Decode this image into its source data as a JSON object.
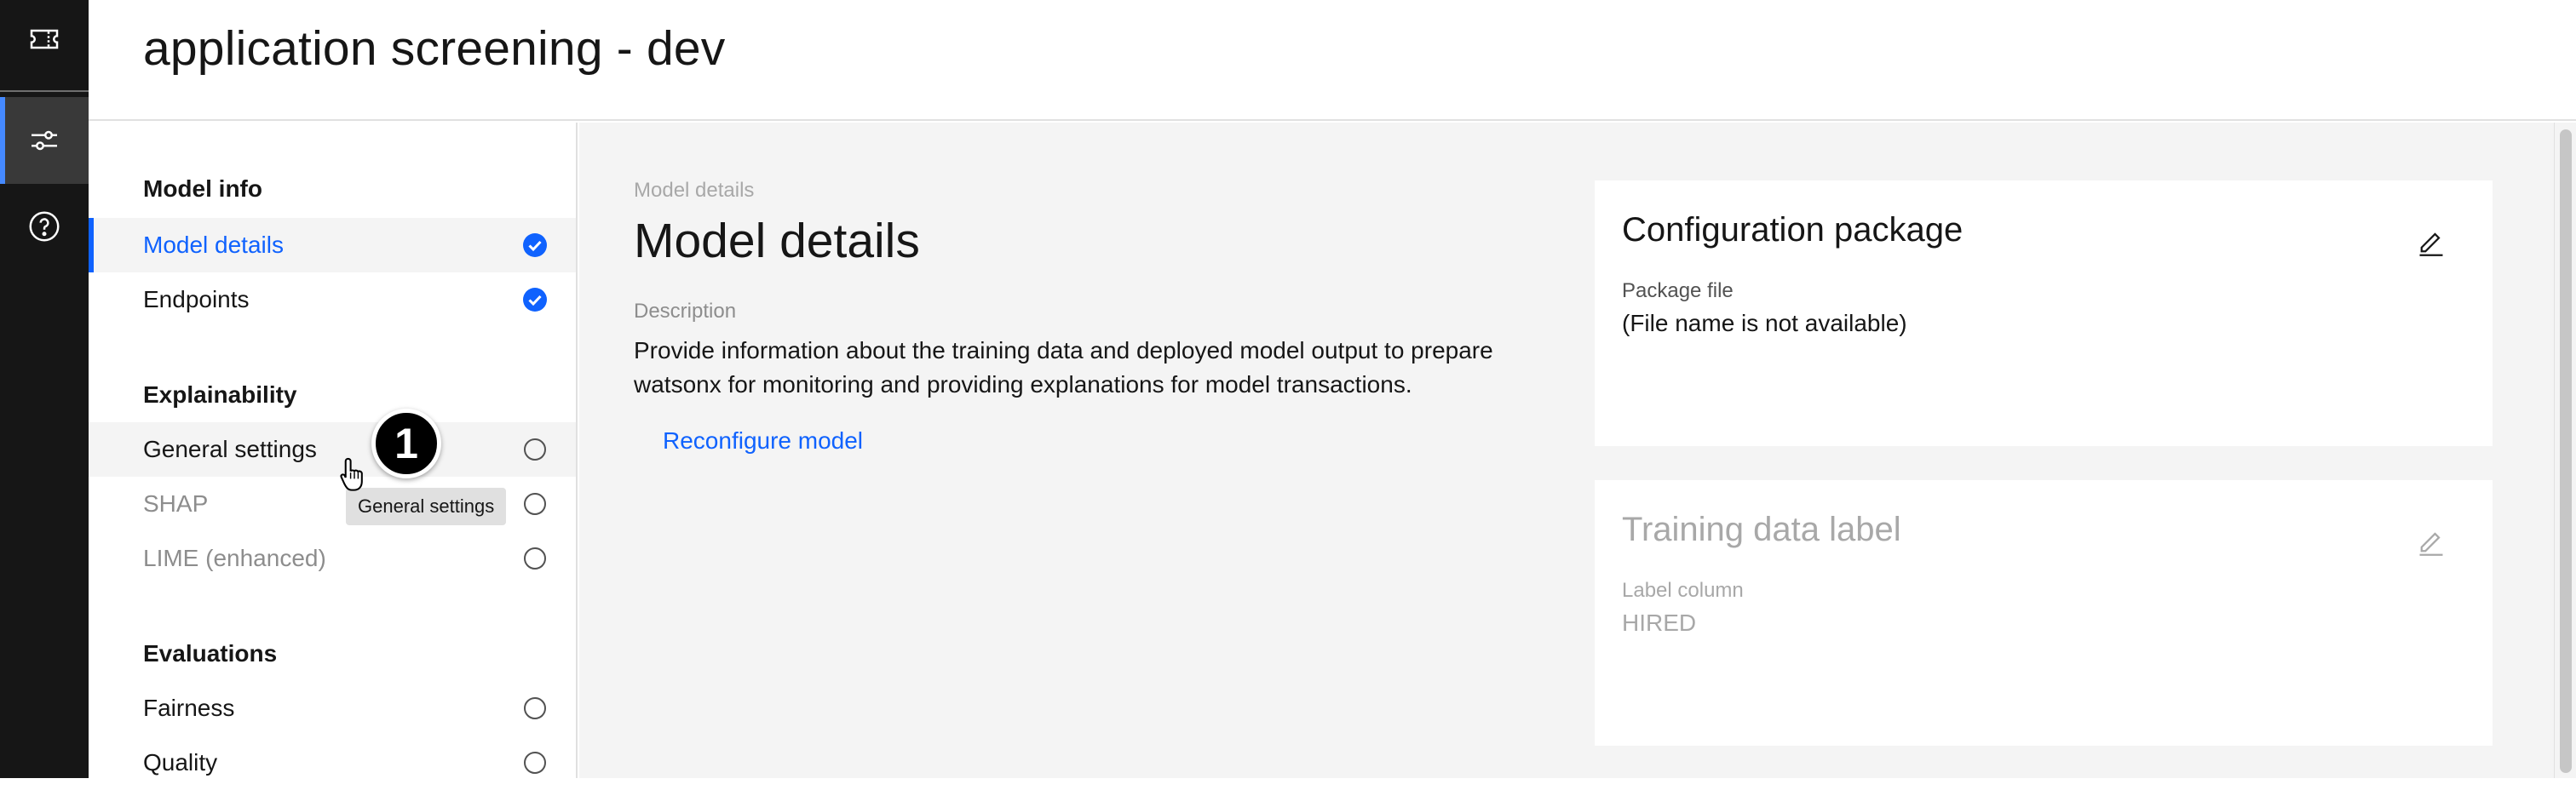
{
  "app": {
    "title": "application screening - dev"
  },
  "rail": {
    "items": [
      {
        "icon": "ticket-icon"
      },
      {
        "icon": "sliders-icon",
        "active": true
      },
      {
        "icon": "help-icon"
      }
    ]
  },
  "sidenav": {
    "sections": [
      {
        "heading": "Model info",
        "items": [
          {
            "label": "Model details",
            "status": "complete",
            "selected": true
          },
          {
            "label": "Endpoints",
            "status": "complete"
          }
        ]
      },
      {
        "heading": "Explainability",
        "items": [
          {
            "label": "General settings",
            "status": "incomplete",
            "hover": true
          },
          {
            "label": "SHAP",
            "status": "incomplete",
            "disabled": true
          },
          {
            "label": "LIME (enhanced)",
            "status": "incomplete",
            "disabled": true
          }
        ]
      },
      {
        "heading": "Evaluations",
        "items": [
          {
            "label": "Fairness",
            "status": "incomplete"
          },
          {
            "label": "Quality",
            "status": "incomplete"
          }
        ]
      }
    ],
    "tooltip": "General settings",
    "step_badge": "1"
  },
  "main": {
    "breadcrumb": "Model details",
    "heading": "Model details",
    "description_label": "Description",
    "description": "Provide information about the training data and deployed model output to prepare watsonx for monitoring and providing explanations for model transactions.",
    "reconfigure_link": "Reconfigure model"
  },
  "cards": {
    "config": {
      "title": "Configuration package",
      "field_label": "Package file",
      "field_value": "(File name is not available)"
    },
    "training": {
      "title": "Training data label",
      "field_label": "Label column",
      "field_value": "HIRED"
    }
  },
  "colors": {
    "accent": "#0f62fe",
    "rail_bg": "#161616",
    "rail_indicator": "#4589ff",
    "content_bg": "#f4f4f4"
  }
}
